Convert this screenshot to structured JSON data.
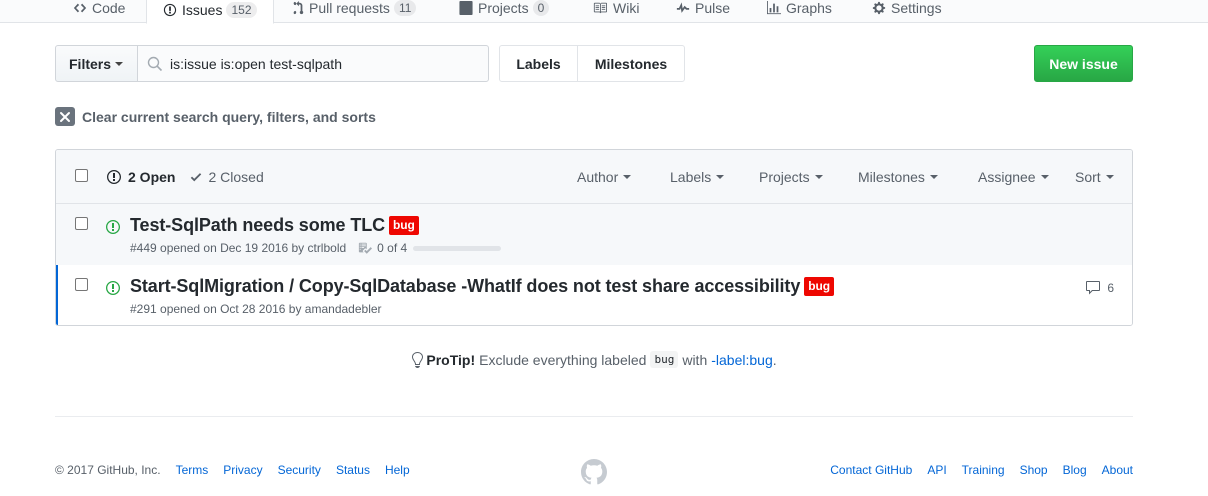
{
  "reponav": {
    "items": [
      {
        "label": "Code",
        "icon": "code-icon"
      },
      {
        "label": "Issues",
        "icon": "issue-opened-icon",
        "counter": "152",
        "selected": true
      },
      {
        "label": "Pull requests",
        "icon": "git-pull-request-icon",
        "counter": "11"
      },
      {
        "label": "Projects",
        "icon": "project-icon",
        "counter": "0"
      },
      {
        "label": "Wiki",
        "icon": "book-icon"
      },
      {
        "label": "Pulse",
        "icon": "pulse-icon"
      },
      {
        "label": "Graphs",
        "icon": "graph-icon"
      },
      {
        "label": "Settings",
        "icon": "gear-icon"
      }
    ]
  },
  "toolbar": {
    "filters_label": "Filters",
    "search_value": "is:issue is:open test-sqlpath",
    "labels_label": "Labels",
    "milestones_label": "Milestones",
    "new_issue_label": "New issue"
  },
  "clear_query_label": "Clear current search query, filters, and sorts",
  "issues_header": {
    "open_label": "2 Open",
    "closed_label": "2 Closed",
    "menus": [
      "Author",
      "Labels",
      "Projects",
      "Milestones",
      "Assignee",
      "Sort"
    ]
  },
  "issues": [
    {
      "title": "Test-SqlPath needs some TLC",
      "label": "bug",
      "label_color": "#ee0701",
      "meta": "#449 opened on Dec 19 2016 by ctrlbold",
      "progress_text": "0 of 4",
      "progress_fraction": 0
    },
    {
      "title": "Start-SqlMigration / Copy-SqlDatabase -WhatIf does not test share accessibility",
      "label": "bug",
      "label_color": "#ee0701",
      "meta": "#291 opened on Oct 28 2016 by amandadebler",
      "comments": "6"
    }
  ],
  "protip": {
    "strong": "ProTip!",
    "text_before": "Exclude everything labeled",
    "code": "bug",
    "text_with": "with",
    "link": "-label:bug",
    "period": "."
  },
  "footer": {
    "copyright": "© 2017 GitHub, Inc.",
    "left_links": [
      "Terms",
      "Privacy",
      "Security",
      "Status",
      "Help"
    ],
    "right_links": [
      "Contact GitHub",
      "API",
      "Training",
      "Shop",
      "Blog",
      "About"
    ]
  },
  "colors": {
    "accent_green": "#28a745",
    "link_blue": "#0366d6",
    "bug_red": "#ee0701",
    "nav_orange": "#e36209"
  }
}
